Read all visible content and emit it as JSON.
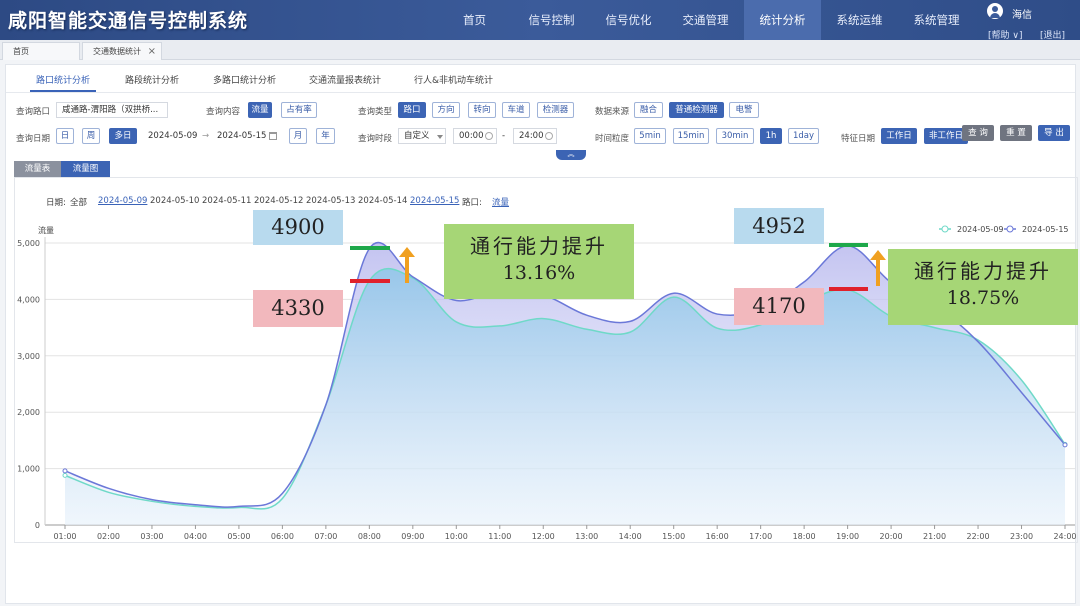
{
  "app": {
    "title": "咸阳智能交通信号控制系统"
  },
  "nav": [
    {
      "label": "首页"
    },
    {
      "label": "信号控制"
    },
    {
      "label": "信号优化"
    },
    {
      "label": "交通管理"
    },
    {
      "label": "统计分析",
      "active": true
    },
    {
      "label": "系统运维"
    },
    {
      "label": "系统管理"
    }
  ],
  "user": {
    "name": "海信",
    "help": "[帮助 ∨]",
    "logout": "[退出]"
  },
  "page_tabs": [
    {
      "label": "首页"
    },
    {
      "label": "交通数据统计",
      "close": "×"
    }
  ],
  "sub_tabs": [
    {
      "label": "路口统计分析",
      "active": true
    },
    {
      "label": "路段统计分析"
    },
    {
      "label": "多路口统计分析"
    },
    {
      "label": "交通流量报表统计"
    },
    {
      "label": "行人&非机动车统计"
    }
  ],
  "filters": {
    "intersection_label": "查询路口",
    "intersection_value": "咸通路-渭阳路（双拱桥...",
    "content_label": "查询内容",
    "content_options": [
      "流量",
      "占有率"
    ],
    "type_label": "查询类型",
    "type_options": [
      "路口",
      "方向",
      "转向",
      "车道",
      "检测器"
    ],
    "source_label": "数据来源",
    "source_options": [
      "融合",
      "普通检测器",
      "电警"
    ],
    "date_label": "查询日期",
    "date_modes": [
      "日",
      "周",
      "多日"
    ],
    "date_start": "2024-05-09",
    "date_arrow": "→",
    "date_end": "2024-05-15",
    "date_modes2": [
      "月",
      "年"
    ],
    "period_label": "查询时段",
    "period_mode": "自定义",
    "time_start": "00:00",
    "time_sep": "-",
    "time_end": "24:00",
    "granularity_label": "时间粒度",
    "granularity_options": [
      "5min",
      "15min",
      "30min",
      "1h",
      "1day"
    ],
    "feature_label": "特征日期",
    "feature_options": [
      "工作日",
      "非工作日"
    ],
    "query_btn": "查 询",
    "reset_btn": "重 置",
    "export_btn": "导 出",
    "collapse_icon": "︽"
  },
  "section_tabs": [
    {
      "label": "流量表"
    },
    {
      "label": "流量图",
      "active": true
    }
  ],
  "date_filter": {
    "label": "日期:",
    "all": "全部",
    "dates": [
      "2024-05-09",
      "2024-05-10",
      "2024-05-11",
      "2024-05-12",
      "2024-05-13",
      "2024-05-14",
      "2024-05-15"
    ],
    "selected": [
      "2024-05-09",
      "2024-05-15"
    ],
    "intersection_label": "路口:",
    "intersection_value": "流量"
  },
  "chart_data": {
    "type": "area",
    "ylabel": "流量",
    "ylim": [
      0,
      5000
    ],
    "yticks": [
      "0",
      "1,000",
      "2,000",
      "3,000",
      "4,000",
      "5,000"
    ],
    "x": [
      "01:00",
      "02:00",
      "03:00",
      "04:00",
      "05:00",
      "06:00",
      "07:00",
      "08:00",
      "09:00",
      "10:00",
      "11:00",
      "12:00",
      "13:00",
      "14:00",
      "15:00",
      "16:00",
      "17:00",
      "18:00",
      "19:00",
      "20:00",
      "21:00",
      "22:00",
      "23:00",
      "24:00"
    ],
    "series": [
      {
        "name": "2024-05-09",
        "color": "#6fd9c8",
        "values": [
          880,
          580,
          420,
          330,
          310,
          470,
          2130,
          4330,
          4380,
          3600,
          3530,
          3660,
          3470,
          3420,
          4040,
          3490,
          3550,
          3950,
          4170,
          3700,
          3500,
          3280,
          2570,
          1430
        ]
      },
      {
        "name": "2024-05-15",
        "color": "#6b78d8",
        "values": [
          960,
          650,
          450,
          360,
          330,
          560,
          2130,
          4900,
          4400,
          3980,
          4150,
          4080,
          3720,
          3610,
          4110,
          3740,
          3820,
          4310,
          4952,
          4300,
          3900,
          3250,
          2350,
          1420
        ]
      }
    ],
    "legend_position": "top-right",
    "grid": true
  },
  "annotations": [
    {
      "value": "4900",
      "style": "blue"
    },
    {
      "value": "4330",
      "style": "red"
    },
    {
      "line1": "通行能力提升",
      "line2": "13.16%",
      "style": "green"
    },
    {
      "value": "4952",
      "style": "blue"
    },
    {
      "value": "4170",
      "style": "red"
    },
    {
      "line1": "通行能力提升",
      "line2": "18.75%",
      "style": "green"
    }
  ]
}
